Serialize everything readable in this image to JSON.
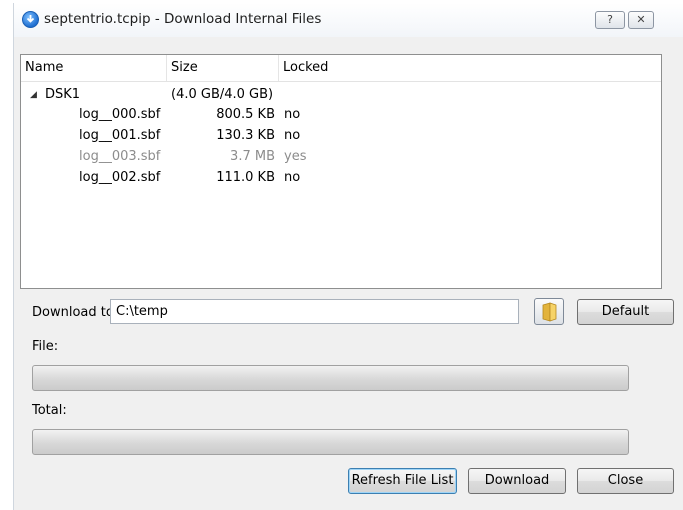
{
  "window": {
    "title": "septentrio.tcpip - Download Internal Files",
    "help_button": "?",
    "close_button": "✕"
  },
  "tree": {
    "columns": [
      "Name",
      "Size",
      "Locked"
    ],
    "drive": {
      "name": "DSK1",
      "size": "(4.0 GB/4.0 GB)",
      "expanded": true
    },
    "files": [
      {
        "name": "log__000.sbf",
        "size": "800.5 KB",
        "locked": "no",
        "dimmed": false
      },
      {
        "name": "log__001.sbf",
        "size": "130.3 KB",
        "locked": "no",
        "dimmed": false
      },
      {
        "name": "log__003.sbf",
        "size": "3.7 MB",
        "locked": "yes",
        "dimmed": true
      },
      {
        "name": "log__002.sbf",
        "size": "111.0 KB",
        "locked": "no",
        "dimmed": false
      }
    ]
  },
  "download": {
    "label": "Download to:",
    "path": "C:\\temp",
    "default_button": "Default"
  },
  "progress": {
    "file_label": "File:",
    "file_progress": 0,
    "total_label": "Total:",
    "total_progress": 0
  },
  "buttons": {
    "refresh": "Refresh File List",
    "download": "Download",
    "close": "Close"
  },
  "colors": {
    "dimmed_text": "#8c8c8c",
    "progress_fill": "#06b025"
  }
}
